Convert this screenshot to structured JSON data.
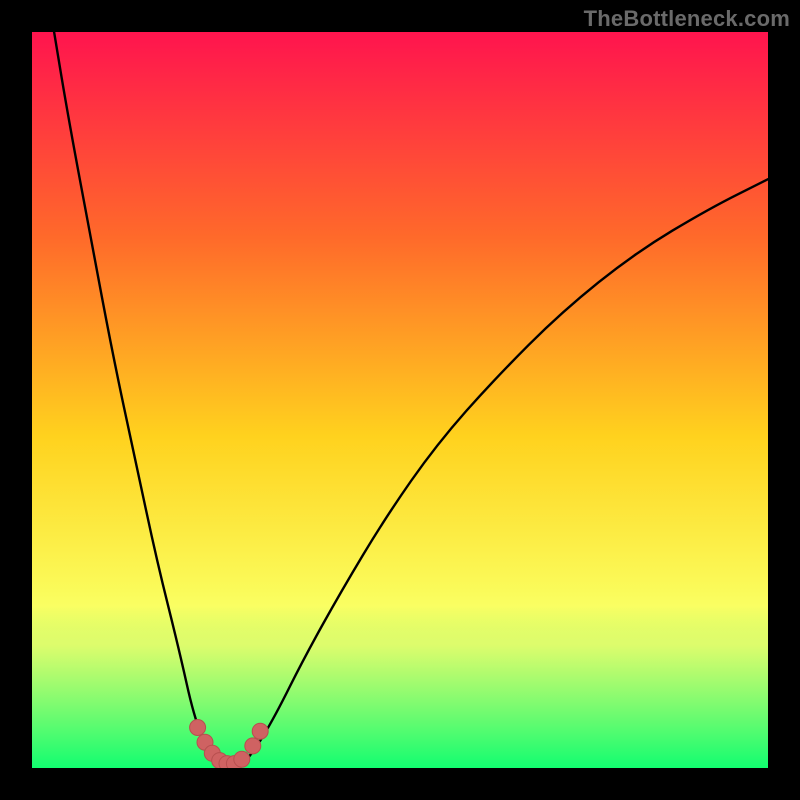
{
  "watermark": "TheBottleneck.com",
  "colors": {
    "frame": "#000000",
    "gradient_top": "#ff144e",
    "gradient_mid1": "#ff6a2a",
    "gradient_mid2": "#ffd21e",
    "gradient_mid3": "#faff60",
    "gradient_bottom": "#00e676",
    "green_haze_top": "#f7ff72",
    "green_haze_bottom": "#13ff6f",
    "curve": "#000000",
    "marker_fill": "#cf6262",
    "marker_stroke": "#b74f4f"
  },
  "chart_data": {
    "type": "line",
    "title": "",
    "xlabel": "",
    "ylabel": "",
    "xlim": [
      0,
      100
    ],
    "ylim": [
      0,
      100
    ],
    "curve_description": "V-shaped bottleneck curve: value drops from ~100 at x≈3 to ~0 around x≈24–30, then rises toward ~80 as x→100.",
    "series": [
      {
        "name": "bottleneck-curve",
        "x": [
          3,
          5,
          8,
          11,
          14,
          17,
          20,
          22,
          24,
          26,
          28,
          30,
          33,
          37,
          42,
          48,
          55,
          63,
          72,
          82,
          92,
          100
        ],
        "y": [
          100,
          88,
          72,
          56,
          42,
          28,
          16,
          7,
          2,
          0,
          0,
          2,
          7,
          15,
          24,
          34,
          44,
          53,
          62,
          70,
          76,
          80
        ]
      }
    ],
    "markers": {
      "name": "highlighted-points",
      "x": [
        22.5,
        23.5,
        24.5,
        25.5,
        26.5,
        27.5,
        28.5,
        30.0,
        31.0
      ],
      "y": [
        5.5,
        3.5,
        2.0,
        1.0,
        0.6,
        0.6,
        1.2,
        3.0,
        5.0
      ]
    }
  }
}
